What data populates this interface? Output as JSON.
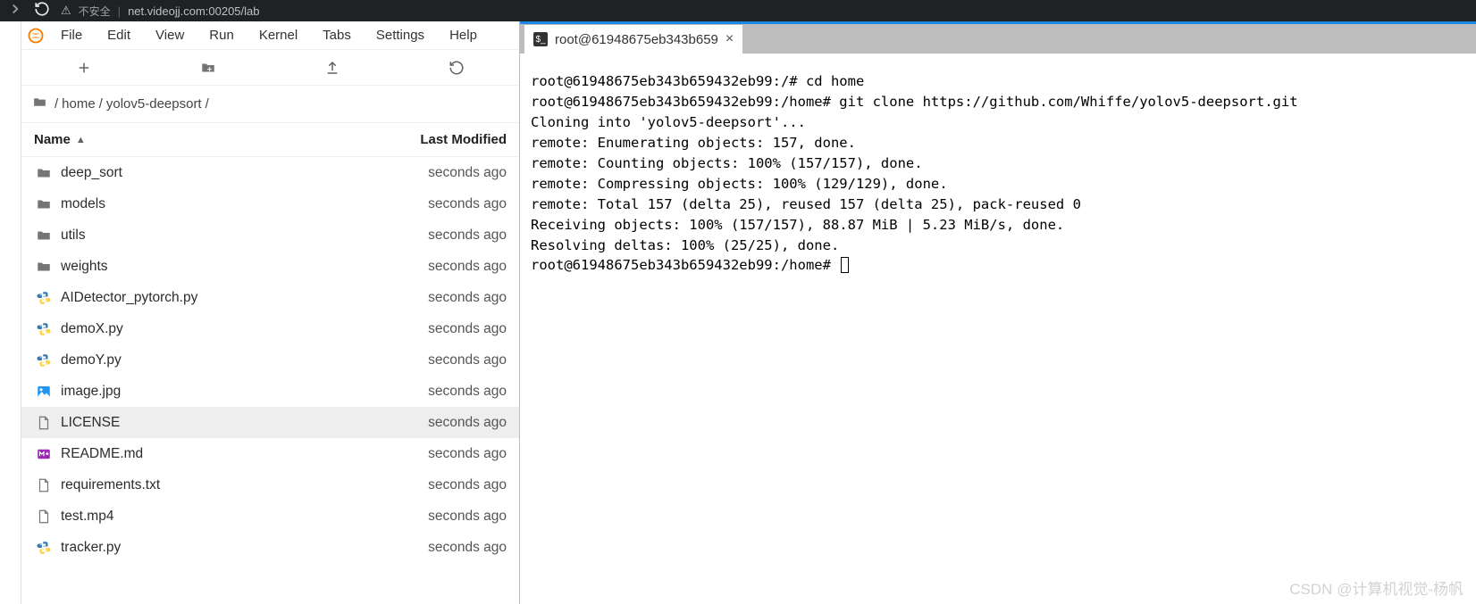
{
  "browser": {
    "security_text": "不安全",
    "url": "net.videojj.com:00205/lab"
  },
  "menu": {
    "file": "File",
    "edit": "Edit",
    "view": "View",
    "run": "Run",
    "kernel": "Kernel",
    "tabs": "Tabs",
    "settings": "Settings",
    "help": "Help"
  },
  "breadcrumb": {
    "sep": "/",
    "parts": [
      "home",
      "yolov5-deepsort"
    ]
  },
  "columns": {
    "name": "Name",
    "modified": "Last Modified"
  },
  "files": [
    {
      "name": "deep_sort",
      "type": "folder",
      "modified": "seconds ago"
    },
    {
      "name": "models",
      "type": "folder",
      "modified": "seconds ago"
    },
    {
      "name": "utils",
      "type": "folder",
      "modified": "seconds ago"
    },
    {
      "name": "weights",
      "type": "folder",
      "modified": "seconds ago"
    },
    {
      "name": "AIDetector_pytorch.py",
      "type": "py",
      "modified": "seconds ago"
    },
    {
      "name": "demoX.py",
      "type": "py",
      "modified": "seconds ago"
    },
    {
      "name": "demoY.py",
      "type": "py",
      "modified": "seconds ago"
    },
    {
      "name": "image.jpg",
      "type": "img",
      "modified": "seconds ago"
    },
    {
      "name": "LICENSE",
      "type": "file",
      "modified": "seconds ago",
      "selected": true
    },
    {
      "name": "README.md",
      "type": "md",
      "modified": "seconds ago"
    },
    {
      "name": "requirements.txt",
      "type": "file",
      "modified": "seconds ago"
    },
    {
      "name": "test.mp4",
      "type": "file",
      "modified": "seconds ago"
    },
    {
      "name": "tracker.py",
      "type": "py",
      "modified": "seconds ago"
    }
  ],
  "tab": {
    "title": "root@61948675eb343b659",
    "term_badge": "$_"
  },
  "terminal_lines": [
    "root@61948675eb343b659432eb99:/# cd home",
    "root@61948675eb343b659432eb99:/home# git clone https://github.com/Whiffe/yolov5-deepsort.git",
    "Cloning into 'yolov5-deepsort'...",
    "remote: Enumerating objects: 157, done.",
    "remote: Counting objects: 100% (157/157), done.",
    "remote: Compressing objects: 100% (129/129), done.",
    "remote: Total 157 (delta 25), reused 157 (delta 25), pack-reused 0",
    "Receiving objects: 100% (157/157), 88.87 MiB | 5.23 MiB/s, done.",
    "Resolving deltas: 100% (25/25), done.",
    "root@61948675eb343b659432eb99:/home# "
  ],
  "watermark": "CSDN @计算机视觉-杨帆"
}
